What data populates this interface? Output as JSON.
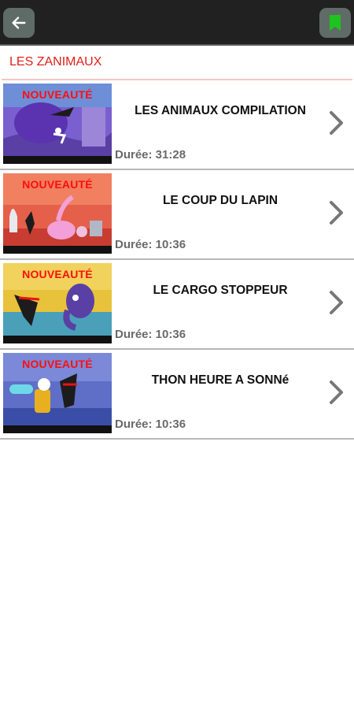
{
  "header": {
    "back_icon": "arrow-left-icon",
    "bookmark_icon": "bookmark-icon",
    "accent_button_bg": "#5f6b66",
    "bookmark_color": "#1ec31e"
  },
  "section": {
    "title": "LES ZANIMAUX",
    "title_color": "#e0201a"
  },
  "videos": [
    {
      "badge": "NOUVEAUTÉ",
      "title": "LES ANIMAUX COMPILATION",
      "duration": "Durée: 31:28"
    },
    {
      "badge": "NOUVEAUTÉ",
      "title": "LE COUP DU LAPIN",
      "duration": "Durée: 10:36"
    },
    {
      "badge": "NOUVEAUTÉ",
      "title": "LE CARGO STOPPEUR",
      "duration": "Durée: 10:36"
    },
    {
      "badge": "NOUVEAUTÉ",
      "title": "THON HEURE A SONNé",
      "duration": "Durée: 10:36"
    }
  ]
}
